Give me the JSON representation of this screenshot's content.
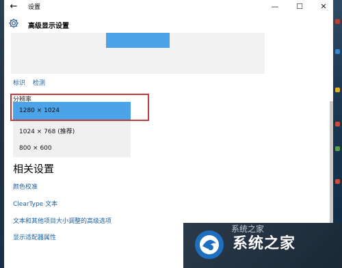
{
  "window": {
    "title": "设置",
    "controls": {
      "minimize": "—",
      "maximize": "☐",
      "close": "✕"
    },
    "back_glyph": "←"
  },
  "header": {
    "title": "高级显示设置",
    "icon": "gear-icon"
  },
  "display": {
    "links": {
      "identify": "标识",
      "detect": "检测"
    }
  },
  "resolution": {
    "label": "分辨率",
    "options": [
      "1280 × 1024",
      "1024 × 768 (推荐)",
      "800 × 600"
    ],
    "selected_index": 0
  },
  "related": {
    "title": "相关设置",
    "links": [
      "颜色校准",
      "ClearType 文本",
      "文本和其他项目大小调整的高级选项",
      "显示适配器属性"
    ]
  },
  "watermark": {
    "text": "系统之家",
    "partial_top": "系统之家"
  },
  "colors": {
    "accent": "#4da3e8",
    "link": "#1a5fa3",
    "highlight_border": "#c0393b"
  }
}
